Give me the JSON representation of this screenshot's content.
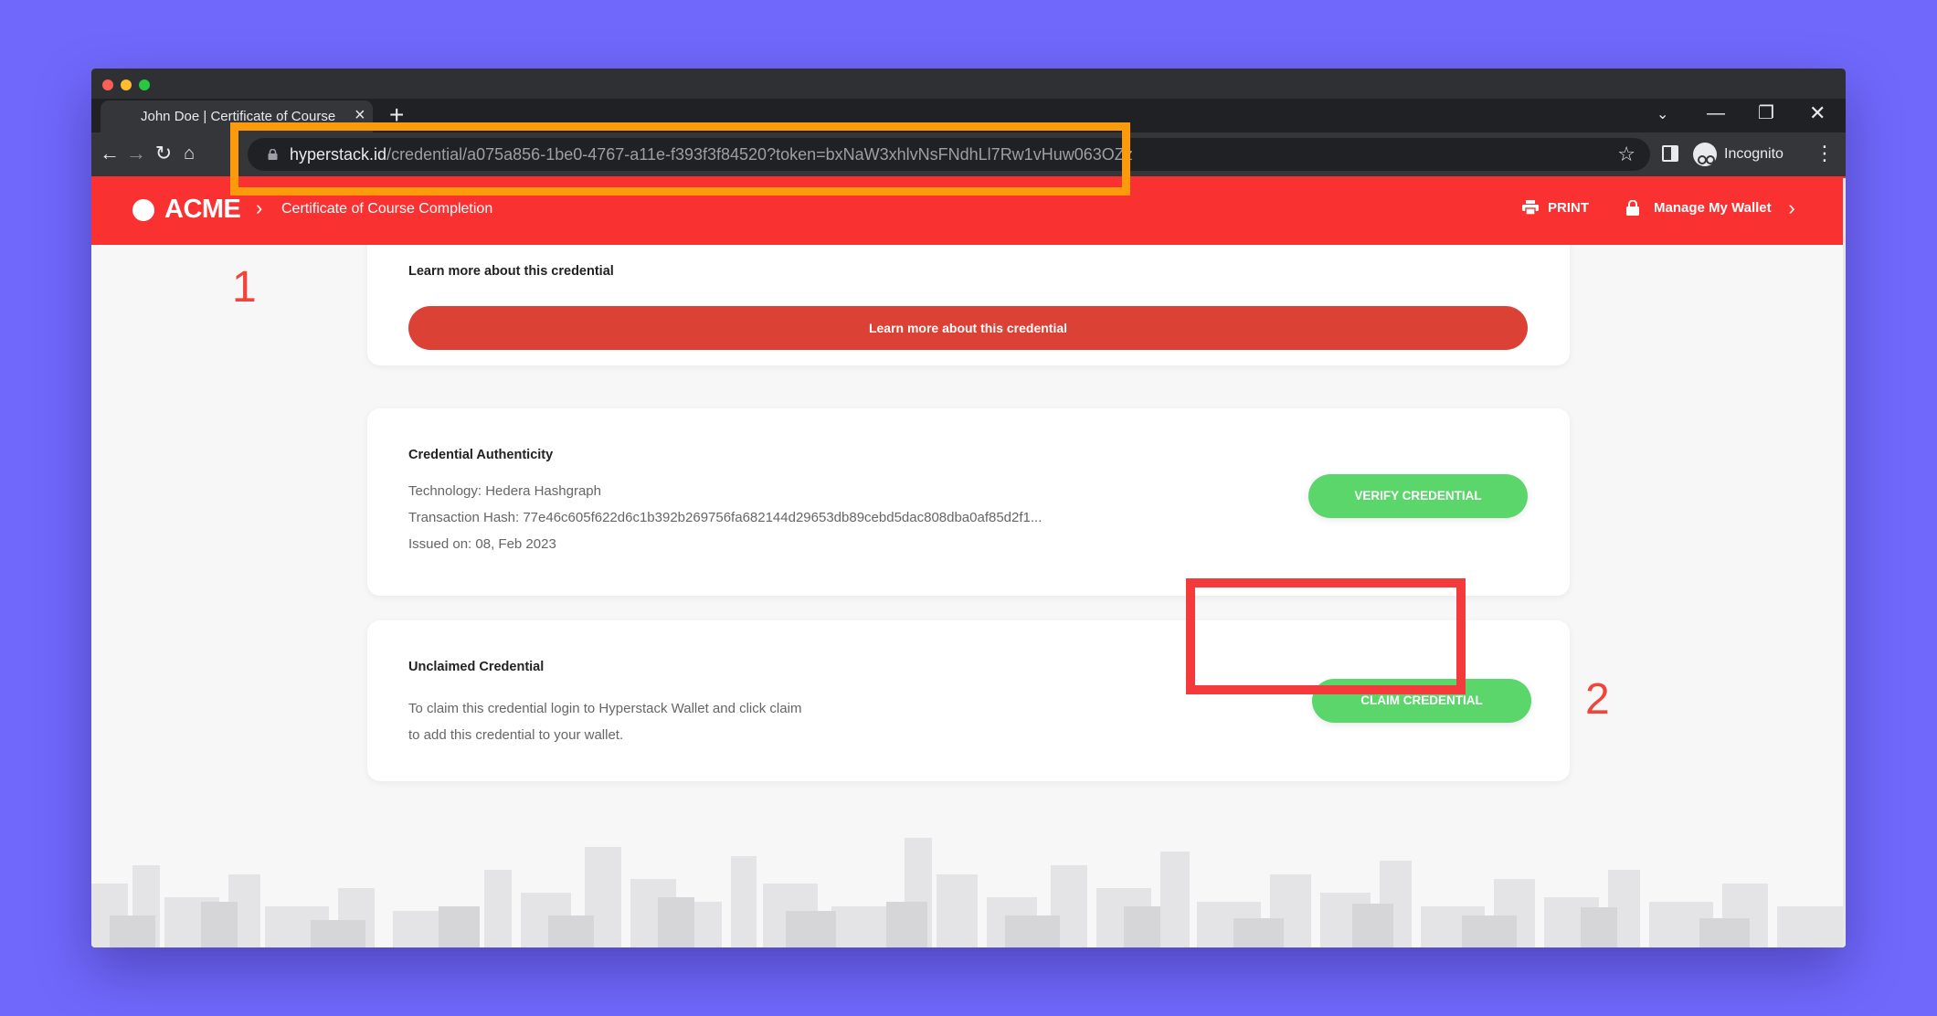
{
  "browser": {
    "tab_title": "John Doe | Certificate of Course Completion",
    "url_host": "hyperstack.id",
    "url_path": "/credential/a075a856-1be0-4767-a11e-f393f3f84520?token=bxNaW3xhlvNsFNdhLl7Rw1vHuw063OZz",
    "profile_label": "Incognito"
  },
  "header": {
    "logo": "ACME",
    "breadcrumb": "Certificate of Course Completion",
    "print_label": "PRINT",
    "wallet_label": "Manage My Wallet"
  },
  "learn_more": {
    "title": "Learn more about this credential",
    "button": "Learn more about this credential"
  },
  "authenticity": {
    "title": "Credential Authenticity",
    "technology": "Technology: Hedera Hashgraph",
    "hash": "Transaction Hash: 77e46c605f622d6c1b392b269756fa682144d29653db89cebd5dac808dba0af85d2f1...",
    "issued": "Issued on: 08, Feb 2023",
    "button": "VERIFY CREDENTIAL"
  },
  "unclaimed": {
    "title": "Unclaimed Credential",
    "line1": "To claim this credential login to Hyperstack Wallet and click claim",
    "line2": "to add this credential to your wallet.",
    "button": "CLAIM CREDENTIAL"
  },
  "annotations": {
    "step1": "1",
    "step2": "2"
  },
  "colors": {
    "background": "#7068fb",
    "brand_red": "#fa3131",
    "button_red": "#dc4136",
    "button_green": "#5bd66b",
    "annotation_orange": "#fb9a0a",
    "annotation_red": "#f43a3a"
  }
}
